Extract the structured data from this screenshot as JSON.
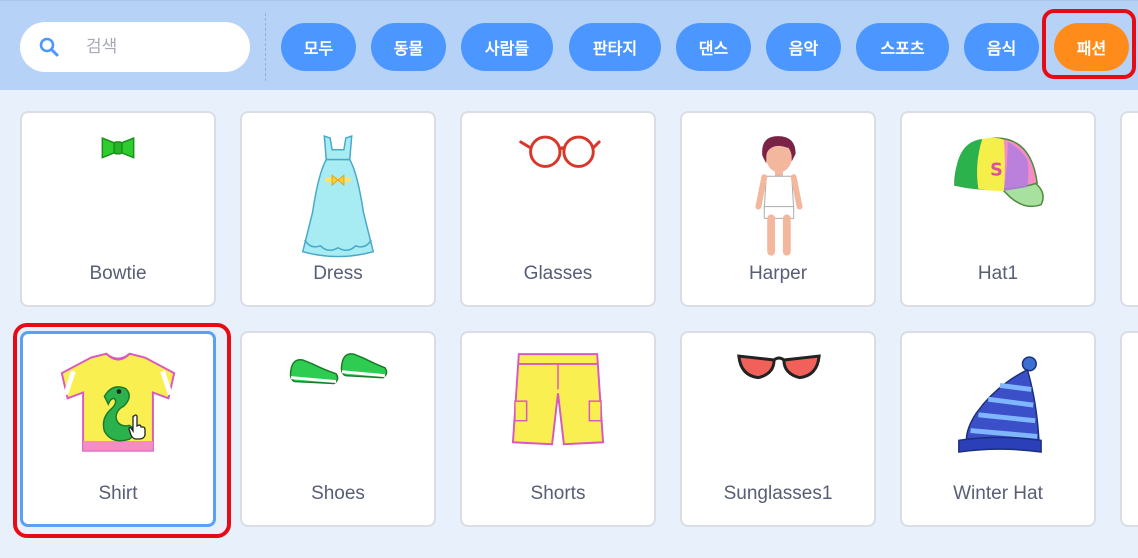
{
  "search": {
    "placeholder": "검색",
    "value": ""
  },
  "categories": [
    {
      "label": "모두"
    },
    {
      "label": "동물"
    },
    {
      "label": "사람들"
    },
    {
      "label": "판타지"
    },
    {
      "label": "댄스"
    },
    {
      "label": "음악"
    },
    {
      "label": "스포츠"
    },
    {
      "label": "음식"
    },
    {
      "label": "패션",
      "active": true
    }
  ],
  "items": [
    {
      "name": "Bowtie"
    },
    {
      "name": "Dress"
    },
    {
      "name": "Glasses"
    },
    {
      "name": "Harper"
    },
    {
      "name": "Hat1"
    },
    {
      "name": "Shirt",
      "selected": true
    },
    {
      "name": "Shoes"
    },
    {
      "name": "Shorts"
    },
    {
      "name": "Sunglasses1"
    },
    {
      "name": "Winter Hat"
    }
  ],
  "colors": {
    "accent": "#4c97ff",
    "active_tag": "#ff8c1a",
    "highlight": "#e60c16",
    "selected_border": "#5aa0f5"
  }
}
